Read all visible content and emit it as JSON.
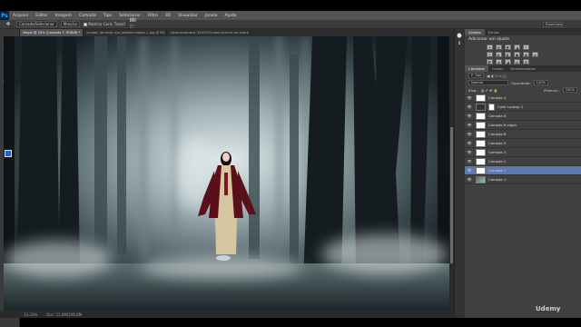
{
  "app": {
    "logo": "Ps"
  },
  "menu": [
    "Arquivo",
    "Editar",
    "Imagem",
    "Camada",
    "Tipo",
    "Selecionar",
    "Filtro",
    "3D",
    "Visualizar",
    "Janela",
    "Ajuda"
  ],
  "options_bar": {
    "tool_preset": "Camada/Selecionar",
    "feather_label": "Mesclar",
    "checkbox_label": "Mostrar Cont. Transf.",
    "workspace": "Essenciais"
  },
  "document_tabs": [
    {
      "label": "Magia @ 33% (Camada 7, RGB/8) *",
      "active": true
    },
    {
      "label": "ciudad, fantasia, ala_alolesimulaesz-1.jpg @ 8% (RGB/8)",
      "active": false
    },
    {
      "label": "dianmandplace_3447293-dark-shrines-for-shark-background.jpg @ 100% (RGB/8)",
      "active": false
    }
  ],
  "status_bar": {
    "zoom": "33,33%",
    "doc_info": "Doc: 11,8M/196,6M"
  },
  "panels": {
    "top_tabs": [
      "Ajustes",
      "Estilos"
    ],
    "adjustments_title": "Adicionar um ajuste",
    "adj_row1": [
      "☀",
      "▥",
      "◩",
      "◪",
      "▽"
    ],
    "adj_row2": [
      "◫",
      "◐",
      "◧",
      "▣",
      "▦",
      "◍"
    ],
    "adj_row3": [
      "◩",
      "◈",
      "◪",
      "▤",
      "▧"
    ],
    "layer_tabs": [
      "Camadas",
      "Canais",
      "Demarcadores"
    ],
    "kind_label": "P. Tipo",
    "blend_mode": "Normal",
    "opacity_label": "Opacidade:",
    "opacity_value": "100%",
    "lock_label": "Bloq.:",
    "fill_label": "Preench.:",
    "fill_value": "100%"
  },
  "layers": [
    {
      "name": "Camada 4",
      "thumb": "white",
      "selected": false
    },
    {
      "name": "Color Lookup 1",
      "thumb": "dark",
      "selected": false
    },
    {
      "name": "Camada 6",
      "thumb": "white",
      "selected": false
    },
    {
      "name": "Camada 6 cópia",
      "thumb": "white",
      "selected": false
    },
    {
      "name": "Camada 8",
      "thumb": "white",
      "selected": false
    },
    {
      "name": "Camada 5",
      "thumb": "white",
      "selected": false
    },
    {
      "name": "Camada 3",
      "thumb": "white",
      "selected": false
    },
    {
      "name": "Camada 2",
      "thumb": "white",
      "selected": false
    },
    {
      "name": "Camada 7",
      "thumb": "white",
      "selected": true
    },
    {
      "name": "Camada 1",
      "thumb": "img",
      "selected": false
    }
  ],
  "watermark": "Udemy"
}
